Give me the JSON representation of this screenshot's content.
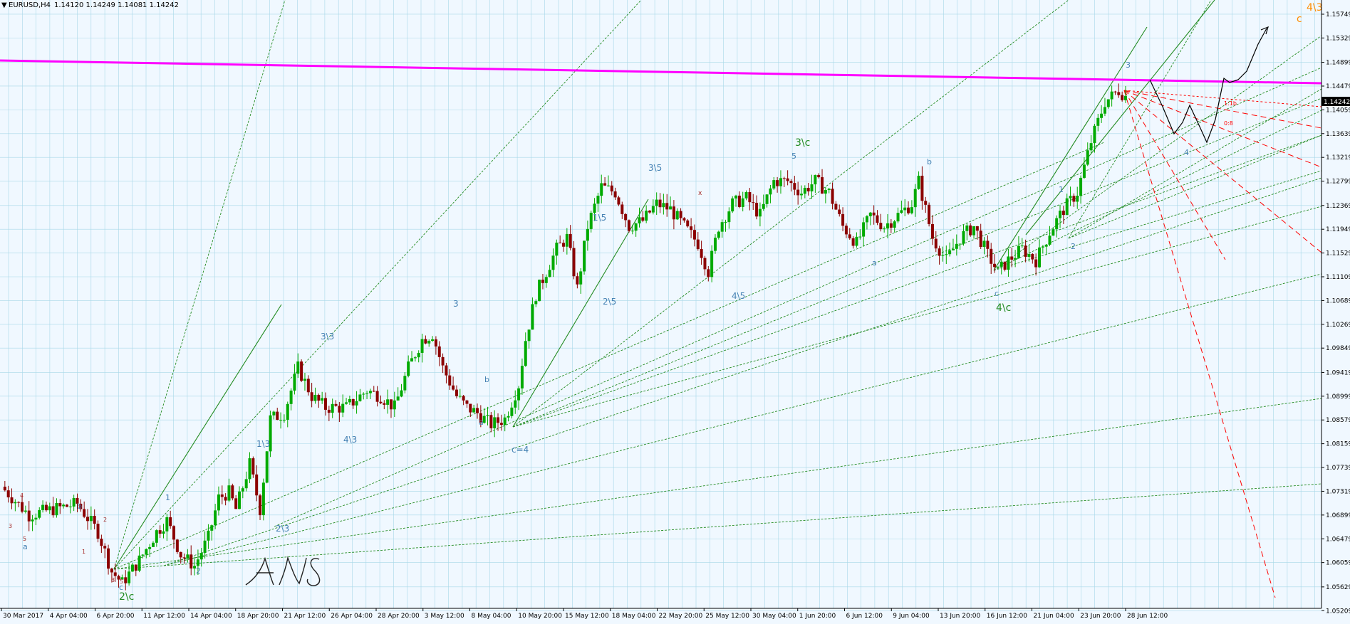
{
  "header": {
    "symbol": "EURUSD,H4",
    "ohlc": "1.14120 1.14249 1.14081 1.14242"
  },
  "colors": {
    "background": "#f0f8ff",
    "grid": "#a8d8e8",
    "bull": "#00aa00",
    "bear": "#8b0000",
    "trend": "#228b22",
    "resistance": "#ff00ff",
    "projection_red": "#ff0000",
    "label_blue": "#4682b4",
    "label_brown": "#a52a2a",
    "label_green": "#228b22",
    "label_orange": "#ff8c00"
  },
  "chart_data": {
    "type": "candlestick",
    "ylim": [
      1.0525,
      1.16
    ],
    "current_price": "1.14242",
    "y_ticks": [
      "1.15749",
      "1.15329",
      "1.14899",
      "1.14479",
      "1.14059",
      "1.13639",
      "1.13219",
      "1.12799",
      "1.12369",
      "1.11949",
      "1.11529",
      "1.11109",
      "1.10689",
      "1.10269",
      "1.09849",
      "1.09419",
      "1.08999",
      "1.08579",
      "1.08159",
      "1.07739",
      "1.07319",
      "1.06899",
      "1.06479",
      "1.06059",
      "1.05629",
      "1.05209"
    ],
    "x_ticks": [
      "30 Mar 2017",
      "4 Apr 04:00",
      "6 Apr 20:00",
      "11 Apr 12:00",
      "14 Apr 04:00",
      "18 Apr 20:00",
      "21 Apr 12:00",
      "26 Apr 04:00",
      "28 Apr 20:00",
      "3 May 12:00",
      "8 May 04:00",
      "10 May 20:00",
      "15 May 12:00",
      "18 May 04:00",
      "22 May 20:00",
      "25 May 12:00",
      "30 May 04:00",
      "1 Jun 20:00",
      "6 Jun 12:00",
      "9 Jun 04:00",
      "13 Jun 20:00",
      "16 Jun 12:00",
      "21 Jun 04:00",
      "23 Jun 20:00",
      "28 Jun 12:00"
    ],
    "path": [
      [
        0,
        1.074
      ],
      [
        8,
        1.069
      ],
      [
        15,
        1.07
      ],
      [
        22,
        1.071
      ],
      [
        28,
        1.066
      ],
      [
        32,
        1.059
      ],
      [
        35,
        1.057
      ],
      [
        40,
        1.061
      ],
      [
        45,
        1.066
      ],
      [
        48,
        1.068
      ],
      [
        52,
        1.062
      ],
      [
        56,
        1.06
      ],
      [
        60,
        1.065
      ],
      [
        63,
        1.072
      ],
      [
        66,
        1.073
      ],
      [
        68,
        1.07
      ],
      [
        72,
        1.078
      ],
      [
        75,
        1.07
      ],
      [
        78,
        1.086
      ],
      [
        82,
        1.087
      ],
      [
        86,
        1.095
      ],
      [
        90,
        1.09
      ],
      [
        94,
        1.088
      ],
      [
        100,
        1.088
      ],
      [
        106,
        1.091
      ],
      [
        110,
        1.09
      ],
      [
        114,
        1.088
      ],
      [
        118,
        1.095
      ],
      [
        122,
        1.1
      ],
      [
        125,
        1.101
      ],
      [
        128,
        1.095
      ],
      [
        132,
        1.09
      ],
      [
        135,
        1.088
      ],
      [
        138,
        1.087
      ],
      [
        142,
        1.085
      ],
      [
        146,
        1.086
      ],
      [
        150,
        1.092
      ],
      [
        152,
        1.1
      ],
      [
        155,
        1.108
      ],
      [
        158,
        1.112
      ],
      [
        161,
        1.116
      ],
      [
        164,
        1.118
      ],
      [
        167,
        1.109
      ],
      [
        170,
        1.12
      ],
      [
        174,
        1.127
      ],
      [
        178,
        1.126
      ],
      [
        182,
        1.12
      ],
      [
        186,
        1.121
      ],
      [
        190,
        1.124
      ],
      [
        194,
        1.123
      ],
      [
        198,
        1.12
      ],
      [
        202,
        1.117
      ],
      [
        205,
        1.112
      ],
      [
        208,
        1.12
      ],
      [
        212,
        1.124
      ],
      [
        216,
        1.125
      ],
      [
        220,
        1.122
      ],
      [
        224,
        1.128
      ],
      [
        228,
        1.128
      ],
      [
        232,
        1.126
      ],
      [
        236,
        1.128
      ],
      [
        240,
        1.126
      ],
      [
        244,
        1.12
      ],
      [
        248,
        1.117
      ],
      [
        252,
        1.122
      ],
      [
        256,
        1.12
      ],
      [
        260,
        1.122
      ],
      [
        264,
        1.124
      ],
      [
        266,
        1.128
      ],
      [
        270,
        1.118
      ],
      [
        274,
        1.114
      ],
      [
        278,
        1.118
      ],
      [
        282,
        1.12
      ],
      [
        286,
        1.115
      ],
      [
        289,
        1.112
      ],
      [
        292,
        1.114
      ],
      [
        296,
        1.116
      ],
      [
        300,
        1.114
      ],
      [
        304,
        1.119
      ],
      [
        308,
        1.123
      ],
      [
        312,
        1.126
      ],
      [
        316,
        1.135
      ],
      [
        320,
        1.142
      ],
      [
        324,
        1.144
      ],
      [
        326,
        1.143
      ]
    ],
    "forecast_path": [
      [
        1614,
        112
      ],
      [
        1632,
        150
      ],
      [
        1648,
        188
      ],
      [
        1660,
        172
      ],
      [
        1670,
        148
      ],
      [
        1684,
        178
      ],
      [
        1694,
        200
      ],
      [
        1706,
        168
      ],
      [
        1718,
        110
      ],
      [
        1726,
        116
      ],
      [
        1738,
        112
      ],
      [
        1750,
        100
      ],
      [
        1766,
        62
      ],
      [
        1778,
        40
      ]
    ]
  },
  "wave_labels": [
    {
      "t": "2\\c",
      "x": 167,
      "y": 843,
      "c": "label_green",
      "s": 14
    },
    {
      "t": "c",
      "x": 167,
      "y": 829,
      "c": "label_blue",
      "s": 11
    },
    {
      "t": "a",
      "x": 32,
      "y": 772,
      "c": "label_blue",
      "s": 11
    },
    {
      "t": "5",
      "x": 32,
      "y": 760,
      "c": "label_brown",
      "s": 8
    },
    {
      "t": "3",
      "x": 12,
      "y": 742,
      "c": "label_brown",
      "s": 8
    },
    {
      "t": "4",
      "x": 28,
      "y": 699,
      "c": "label_brown",
      "s": 8
    },
    {
      "t": "b",
      "x": 108,
      "y": 715,
      "c": "label_blue",
      "s": 11
    },
    {
      "t": "1",
      "x": 115,
      "y": 778,
      "c": "label_brown",
      "s": 8
    },
    {
      "t": "2",
      "x": 145,
      "y": 733,
      "c": "label_brown",
      "s": 8
    },
    {
      "t": "3",
      "x": 156,
      "y": 818,
      "c": "label_brown",
      "s": 8
    },
    {
      "t": "5",
      "x": 168,
      "y": 820,
      "c": "label_brown",
      "s": 8
    },
    {
      "t": "1",
      "x": 232,
      "y": 703,
      "c": "label_blue",
      "s": 11
    },
    {
      "t": "2",
      "x": 275,
      "y": 806,
      "c": "label_blue",
      "s": 11
    },
    {
      "t": "1\\3",
      "x": 360,
      "y": 628,
      "c": "label_blue",
      "s": 12
    },
    {
      "t": "2\\3",
      "x": 387,
      "y": 747,
      "c": "label_blue",
      "s": 12
    },
    {
      "t": "3\\3",
      "x": 450,
      "y": 477,
      "c": "label_blue",
      "s": 12
    },
    {
      "t": "4\\3",
      "x": 482,
      "y": 622,
      "c": "label_blue",
      "s": 12
    },
    {
      "t": "3",
      "x": 636,
      "y": 431,
      "c": "label_blue",
      "s": 12
    },
    {
      "t": "a",
      "x": 672,
      "y": 597,
      "c": "label_blue",
      "s": 11
    },
    {
      "t": "b",
      "x": 680,
      "y": 537,
      "c": "label_blue",
      "s": 11
    },
    {
      "t": "c=4",
      "x": 718,
      "y": 636,
      "c": "label_blue",
      "s": 12
    },
    {
      "t": "1\\5",
      "x": 832,
      "y": 310,
      "c": "label_blue",
      "s": 12
    },
    {
      "t": "2\\5",
      "x": 846,
      "y": 428,
      "c": "label_blue",
      "s": 12
    },
    {
      "t": "3\\5",
      "x": 910,
      "y": 240,
      "c": "label_blue",
      "s": 12
    },
    {
      "t": "4\\5",
      "x": 1027,
      "y": 420,
      "c": "label_blue",
      "s": 12
    },
    {
      "t": "3\\c",
      "x": 1116,
      "y": 205,
      "c": "label_green",
      "s": 14
    },
    {
      "t": "5",
      "x": 1111,
      "y": 223,
      "c": "label_blue",
      "s": 11
    },
    {
      "t": "a",
      "x": 1224,
      "y": 373,
      "c": "label_blue",
      "s": 11
    },
    {
      "t": "b",
      "x": 1301,
      "y": 231,
      "c": "label_blue",
      "s": 11
    },
    {
      "t": "4\\c",
      "x": 1398,
      "y": 437,
      "c": "label_green",
      "s": 14
    },
    {
      "t": "c",
      "x": 1396,
      "y": 416,
      "c": "label_blue",
      "s": 11
    },
    {
      "t": "1",
      "x": 1486,
      "y": 270,
      "c": "label_blue",
      "s": 11
    },
    {
      "t": "2",
      "x": 1503,
      "y": 350,
      "c": "label_blue",
      "s": 11
    },
    {
      "t": "3",
      "x": 1580,
      "y": 95,
      "c": "label_blue",
      "s": 11
    },
    {
      "t": "4",
      "x": 1662,
      "y": 218,
      "c": "label_blue",
      "s": 11
    },
    {
      "t": "4\\3",
      "x": 1834,
      "y": 15,
      "c": "label_orange",
      "s": 14
    },
    {
      "t": "c",
      "x": 1820,
      "y": 31,
      "c": "label_orange",
      "s": 14
    },
    {
      "t": "x",
      "x": 980,
      "y": 274,
      "c": "label_brown",
      "s": 9
    }
  ],
  "level_labels": [
    {
      "t": "1:1b",
      "x": 1718,
      "y": 148
    },
    {
      "t": "0:8",
      "x": 1718,
      "y": 176
    }
  ],
  "signature_text": "ANS"
}
